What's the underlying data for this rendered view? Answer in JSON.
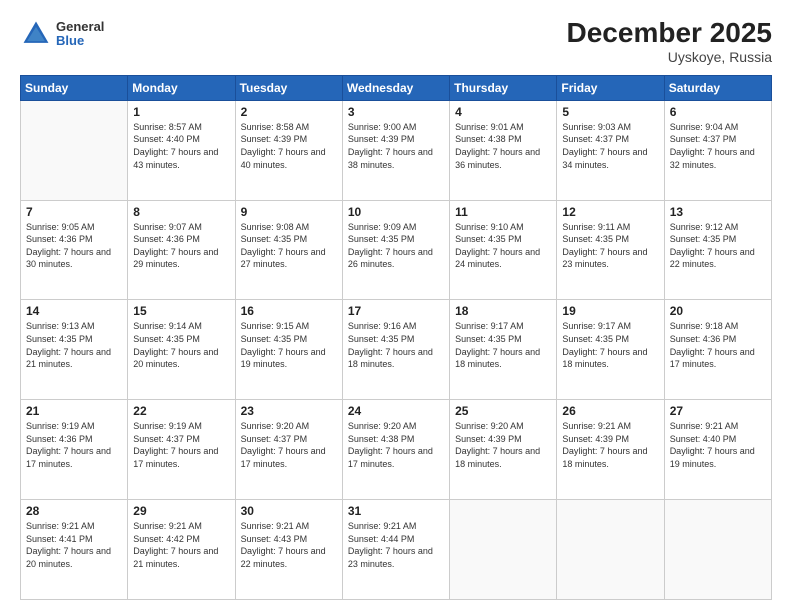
{
  "header": {
    "logo_general": "General",
    "logo_blue": "Blue",
    "title": "December 2025",
    "subtitle": "Uyskoye, Russia"
  },
  "calendar": {
    "days_of_week": [
      "Sunday",
      "Monday",
      "Tuesday",
      "Wednesday",
      "Thursday",
      "Friday",
      "Saturday"
    ],
    "weeks": [
      [
        {
          "day": "",
          "sunrise": "",
          "sunset": "",
          "daylight": "",
          "empty": true
        },
        {
          "day": "1",
          "sunrise": "8:57 AM",
          "sunset": "4:40 PM",
          "daylight": "7 hours and 43 minutes."
        },
        {
          "day": "2",
          "sunrise": "8:58 AM",
          "sunset": "4:39 PM",
          "daylight": "7 hours and 40 minutes."
        },
        {
          "day": "3",
          "sunrise": "9:00 AM",
          "sunset": "4:39 PM",
          "daylight": "7 hours and 38 minutes."
        },
        {
          "day": "4",
          "sunrise": "9:01 AM",
          "sunset": "4:38 PM",
          "daylight": "7 hours and 36 minutes."
        },
        {
          "day": "5",
          "sunrise": "9:03 AM",
          "sunset": "4:37 PM",
          "daylight": "7 hours and 34 minutes."
        },
        {
          "day": "6",
          "sunrise": "9:04 AM",
          "sunset": "4:37 PM",
          "daylight": "7 hours and 32 minutes."
        }
      ],
      [
        {
          "day": "7",
          "sunrise": "9:05 AM",
          "sunset": "4:36 PM",
          "daylight": "7 hours and 30 minutes."
        },
        {
          "day": "8",
          "sunrise": "9:07 AM",
          "sunset": "4:36 PM",
          "daylight": "7 hours and 29 minutes."
        },
        {
          "day": "9",
          "sunrise": "9:08 AM",
          "sunset": "4:35 PM",
          "daylight": "7 hours and 27 minutes."
        },
        {
          "day": "10",
          "sunrise": "9:09 AM",
          "sunset": "4:35 PM",
          "daylight": "7 hours and 26 minutes."
        },
        {
          "day": "11",
          "sunrise": "9:10 AM",
          "sunset": "4:35 PM",
          "daylight": "7 hours and 24 minutes."
        },
        {
          "day": "12",
          "sunrise": "9:11 AM",
          "sunset": "4:35 PM",
          "daylight": "7 hours and 23 minutes."
        },
        {
          "day": "13",
          "sunrise": "9:12 AM",
          "sunset": "4:35 PM",
          "daylight": "7 hours and 22 minutes."
        }
      ],
      [
        {
          "day": "14",
          "sunrise": "9:13 AM",
          "sunset": "4:35 PM",
          "daylight": "7 hours and 21 minutes."
        },
        {
          "day": "15",
          "sunrise": "9:14 AM",
          "sunset": "4:35 PM",
          "daylight": "7 hours and 20 minutes."
        },
        {
          "day": "16",
          "sunrise": "9:15 AM",
          "sunset": "4:35 PM",
          "daylight": "7 hours and 19 minutes."
        },
        {
          "day": "17",
          "sunrise": "9:16 AM",
          "sunset": "4:35 PM",
          "daylight": "7 hours and 18 minutes."
        },
        {
          "day": "18",
          "sunrise": "9:17 AM",
          "sunset": "4:35 PM",
          "daylight": "7 hours and 18 minutes."
        },
        {
          "day": "19",
          "sunrise": "9:17 AM",
          "sunset": "4:35 PM",
          "daylight": "7 hours and 18 minutes."
        },
        {
          "day": "20",
          "sunrise": "9:18 AM",
          "sunset": "4:36 PM",
          "daylight": "7 hours and 17 minutes."
        }
      ],
      [
        {
          "day": "21",
          "sunrise": "9:19 AM",
          "sunset": "4:36 PM",
          "daylight": "7 hours and 17 minutes."
        },
        {
          "day": "22",
          "sunrise": "9:19 AM",
          "sunset": "4:37 PM",
          "daylight": "7 hours and 17 minutes."
        },
        {
          "day": "23",
          "sunrise": "9:20 AM",
          "sunset": "4:37 PM",
          "daylight": "7 hours and 17 minutes."
        },
        {
          "day": "24",
          "sunrise": "9:20 AM",
          "sunset": "4:38 PM",
          "daylight": "7 hours and 17 minutes."
        },
        {
          "day": "25",
          "sunrise": "9:20 AM",
          "sunset": "4:39 PM",
          "daylight": "7 hours and 18 minutes."
        },
        {
          "day": "26",
          "sunrise": "9:21 AM",
          "sunset": "4:39 PM",
          "daylight": "7 hours and 18 minutes."
        },
        {
          "day": "27",
          "sunrise": "9:21 AM",
          "sunset": "4:40 PM",
          "daylight": "7 hours and 19 minutes."
        }
      ],
      [
        {
          "day": "28",
          "sunrise": "9:21 AM",
          "sunset": "4:41 PM",
          "daylight": "7 hours and 20 minutes."
        },
        {
          "day": "29",
          "sunrise": "9:21 AM",
          "sunset": "4:42 PM",
          "daylight": "7 hours and 21 minutes."
        },
        {
          "day": "30",
          "sunrise": "9:21 AM",
          "sunset": "4:43 PM",
          "daylight": "7 hours and 22 minutes."
        },
        {
          "day": "31",
          "sunrise": "9:21 AM",
          "sunset": "4:44 PM",
          "daylight": "7 hours and 23 minutes."
        },
        {
          "day": "",
          "sunrise": "",
          "sunset": "",
          "daylight": "",
          "empty": true
        },
        {
          "day": "",
          "sunrise": "",
          "sunset": "",
          "daylight": "",
          "empty": true
        },
        {
          "day": "",
          "sunrise": "",
          "sunset": "",
          "daylight": "",
          "empty": true
        }
      ]
    ]
  }
}
